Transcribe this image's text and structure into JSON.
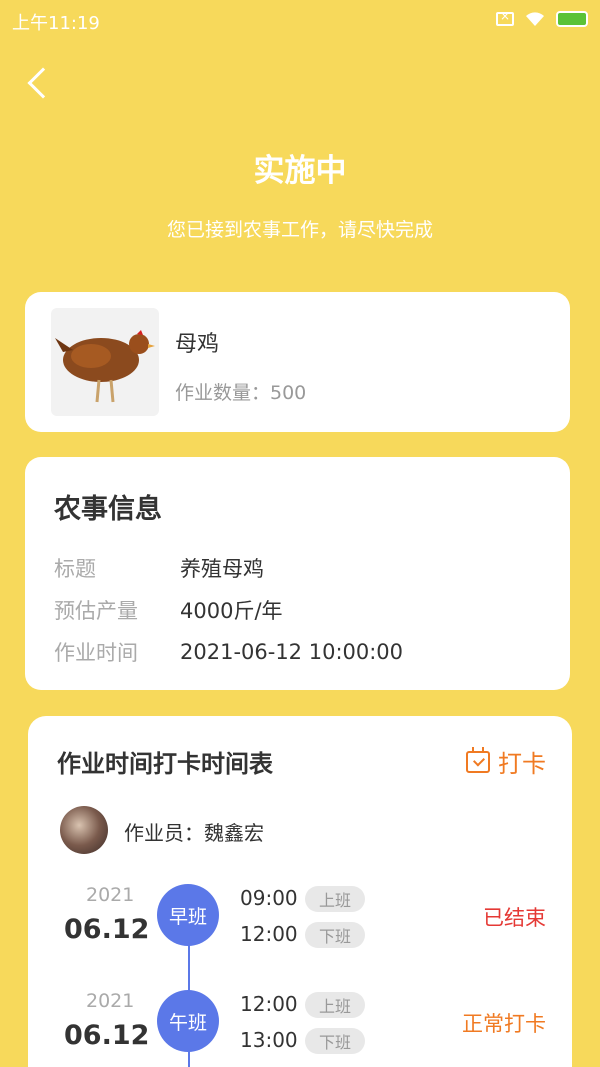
{
  "status_bar": {
    "time": "上午11:19"
  },
  "header": {
    "title": "实施中",
    "subtitle": "您已接到农事工作，请尽快完成"
  },
  "product": {
    "name": "母鸡",
    "quantity": "作业数量：500"
  },
  "info": {
    "title": "农事信息",
    "rows": [
      {
        "label": "标题",
        "value": "养殖母鸡"
      },
      {
        "label": "预估产量",
        "value": "4000斤/年"
      },
      {
        "label": "作业时间",
        "value": "2021-06-12 10:00:00"
      }
    ]
  },
  "schedule": {
    "title": "作业时间打卡时间表",
    "checkin_label": "打卡",
    "worker": "作业员：魏鑫宏",
    "shifts": [
      {
        "year": "2021",
        "date": "06.12",
        "name": "早班",
        "start": "09:00",
        "start_tag": "上班",
        "end": "12:00",
        "end_tag": "下班",
        "status": "已结束",
        "status_color": "#E53935"
      },
      {
        "year": "2021",
        "date": "06.12",
        "name": "午班",
        "start": "12:00",
        "start_tag": "上班",
        "end": "13:00",
        "end_tag": "下班",
        "status": "正常打卡",
        "status_color": "#F07A22"
      }
    ]
  },
  "colors": {
    "background": "#F7D95B",
    "accent_blue": "#5B78E8",
    "accent_orange": "#F07A22",
    "ended_red": "#E53935"
  }
}
